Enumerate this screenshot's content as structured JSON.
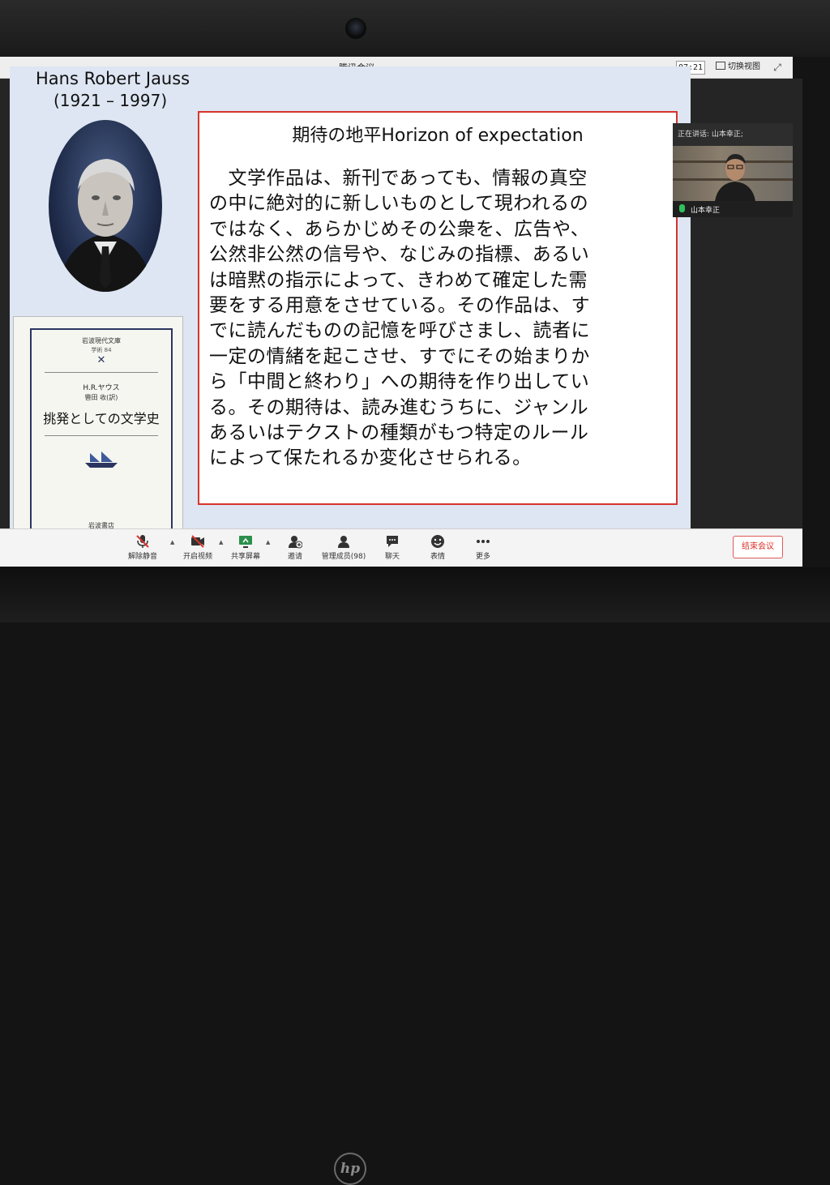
{
  "window": {
    "title": "腾讯会议",
    "timer": "07:21",
    "switch_view_label": "切换视图"
  },
  "slide": {
    "author_name": "Hans Robert Jauss",
    "author_years": "(1921 – 1997)",
    "book": {
      "series": "岩波現代文庫",
      "number": "学術 84",
      "mark": "✕",
      "author": "H.R.ヤウス",
      "translator": "轡田 收(訳)",
      "title": "挑発としての文学史",
      "publisher": "岩波書店"
    },
    "box": {
      "heading": "期待の地平Horizon of expectation",
      "lines": [
        "　文学作品は、新刊であっても、情報の真空",
        "の中に絶対的に新しいものとして現われるの",
        "ではなく、あらかじめその公衆を、広告や、",
        "公然非公然の信号や、なじみの指標、あるい",
        "は暗黙の指示によって、きわめて確定した需",
        "要をする用意をさせている。その作品は、す",
        "でに読んだものの記憶を呼びさまし、読者に",
        "一定の情緒を起こさせ、すでにその始まりか",
        "ら「中間と終わり」への期待を作り出してい",
        "る。その期待は、読み進むうちに、ジャンル",
        "あるいはテクストの種類がもつ特定のルール",
        "によって保たれるか変化させられる。"
      ]
    }
  },
  "video": {
    "speaking_label": "正在讲话: 山本幸正;",
    "participant_name": "山本幸正"
  },
  "toolbar": {
    "unmute": "解除静音",
    "start_video": "开启视频",
    "share_screen": "共享屏幕",
    "invite": "邀请",
    "manage_members": "管理成员(98)",
    "chat": "聊天",
    "reactions": "表情",
    "more": "更多",
    "end_meeting": "结束会议"
  },
  "colors": {
    "slide_background": "#dde6f2",
    "box_border": "#d9332b",
    "end_button": "#d9332b",
    "mic_active": "#2fbf5b"
  }
}
